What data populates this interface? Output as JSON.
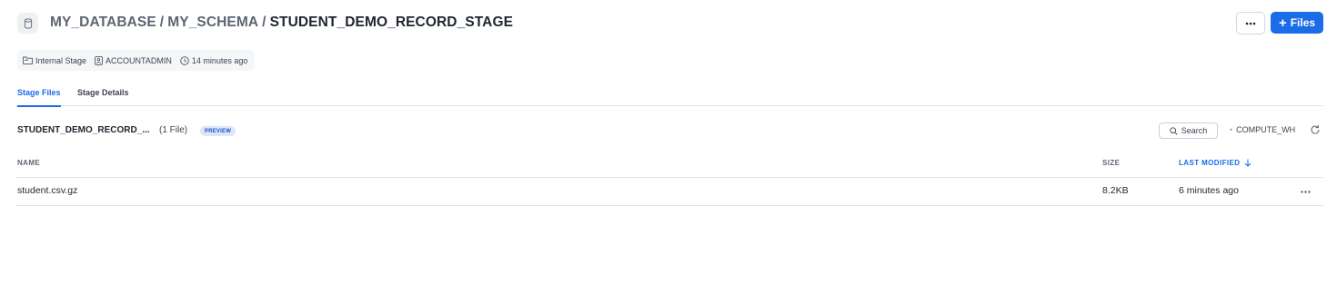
{
  "header": {
    "breadcrumb": [
      "MY_DATABASE",
      "MY_SCHEMA"
    ],
    "separator": "/",
    "current": "STUDENT_DEMO_RECORD_STAGE",
    "icon": "database-stage-icon",
    "more_icon": "ellipsis-icon",
    "files_button_icon": "plus-icon",
    "files_button_label": "Files"
  },
  "meta": {
    "stage_type": "Internal Stage",
    "owner_role": "ACCOUNTADMIN",
    "created": "14 minutes ago"
  },
  "tabs": [
    {
      "label": "Stage Files",
      "active": true
    },
    {
      "label": "Stage Details",
      "active": false
    }
  ],
  "file_list": {
    "title": "STUDENT_DEMO_RECORD_...",
    "count": "(1 File)",
    "badge": "PREVIEW",
    "search_label": "Search",
    "warehouse": "COMPUTE_WH",
    "columns": {
      "name": "NAME",
      "size": "SIZE",
      "modified": "LAST MODIFIED"
    },
    "sort": {
      "column": "LAST MODIFIED",
      "direction": "descending"
    },
    "rows": [
      {
        "name": "student.csv.gz",
        "size": "8.2KB",
        "modified": "6 minutes ago"
      }
    ]
  },
  "colors": {
    "accent": "#1a6ce7",
    "badge_bg": "#dbe6fb",
    "text": "#1e252f",
    "muted": "#5d6573"
  }
}
